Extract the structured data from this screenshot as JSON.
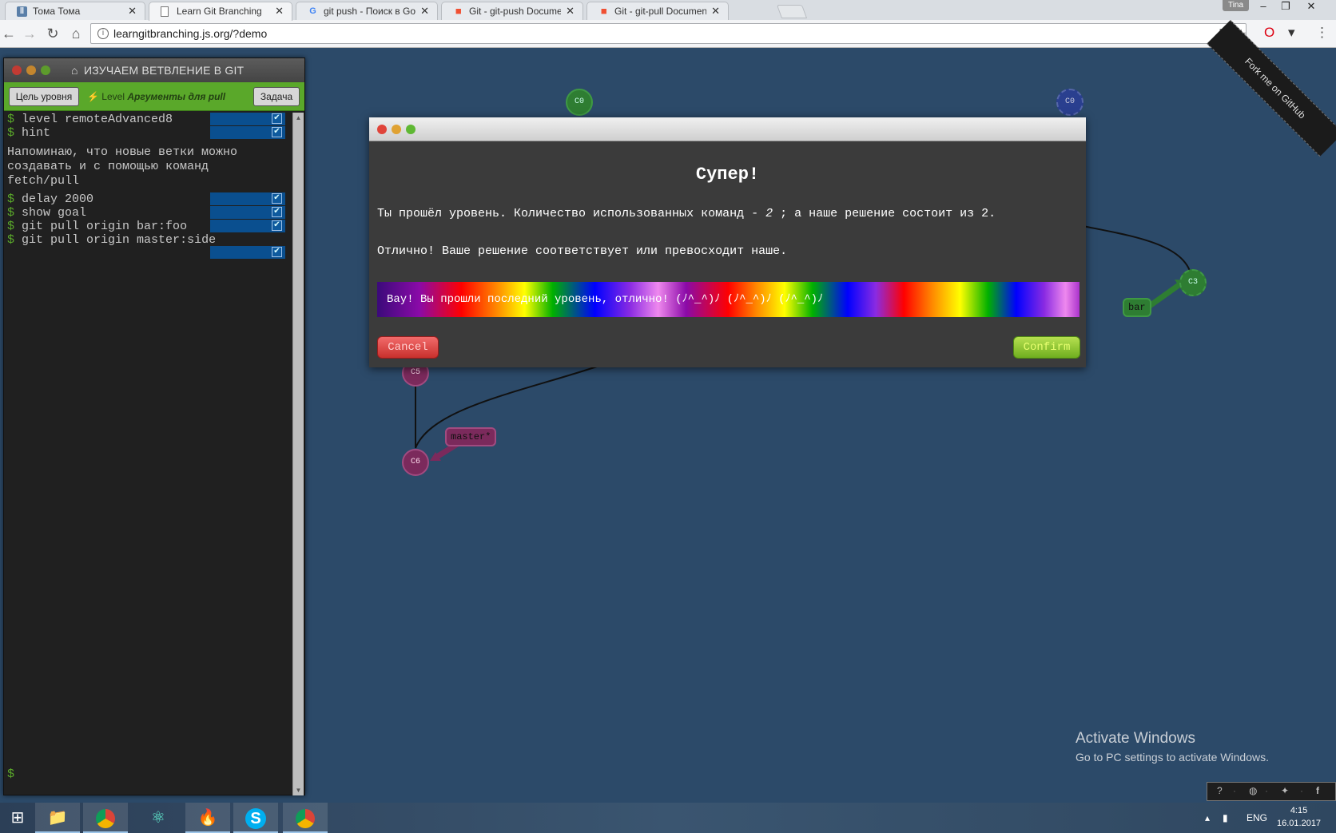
{
  "browser": {
    "tabs": [
      {
        "title": "Тома Тома",
        "icon": "pause-icon",
        "active": false
      },
      {
        "title": "Learn Git Branching",
        "icon": "page-icon",
        "active": true
      },
      {
        "title": "git push - Поиск в Goog",
        "icon": "google-icon",
        "active": false
      },
      {
        "title": "Git - git-push Document",
        "icon": "git-icon",
        "active": false
      },
      {
        "title": "Git - git-pull Documenta",
        "icon": "git-icon",
        "active": false
      }
    ],
    "user": "Tina",
    "url": "learngitbranching.js.org/?demo"
  },
  "panel": {
    "title": "ИЗУЧАЕМ ВЕТВЛЕНИЕ В GIT",
    "goal_button": "Цель уровня",
    "level_prefix": "Level",
    "level_name": "Аргументы для pull",
    "task_button": "Задача",
    "commands": [
      "level remoteAdvanced8",
      "hint",
      "delay 2000",
      "show goal",
      "git pull origin bar:foo",
      "git pull origin master:side"
    ],
    "hint_text": "Напоминаю, что новые ветки можно\nсоздавать и с помощью команд\nfetch/pull",
    "prompt": "$"
  },
  "graph": {
    "nodes": [
      "C0",
      "C0",
      "C3",
      "C5",
      "C6"
    ],
    "branches": [
      "bar",
      "master*"
    ],
    "ribbon": "Fork me on GitHub"
  },
  "modal": {
    "title": "Супер!",
    "line1_prefix": "Ты прошёл уровень. Количество использованных команд - ",
    "line1_count": "2",
    "line1_suffix": " ; а наше решение состоит из 2.",
    "line2": "Отлично! Ваше решение соответствует или превосходит наше.",
    "rainbow": "Вау! Вы прошли последний уровень, отлично! (ﾉ^_^)ﾉ (ﾉ^_^)ﾉ (ﾉ^_^)ﾉ",
    "cancel": "Cancel",
    "confirm": "Confirm"
  },
  "watermark": {
    "title": "Activate Windows",
    "subtitle": "Go to PC settings to activate Windows."
  },
  "taskbar": {
    "lang": "ENG",
    "time": "4:15",
    "date": "16.01.2017"
  },
  "colors": {
    "canvas": "#2c4a69",
    "panel_green": "#5aa82a",
    "node_green": "#2e7d32",
    "node_blue": "#2a3f8f",
    "node_magenta": "#7b2a5c"
  }
}
